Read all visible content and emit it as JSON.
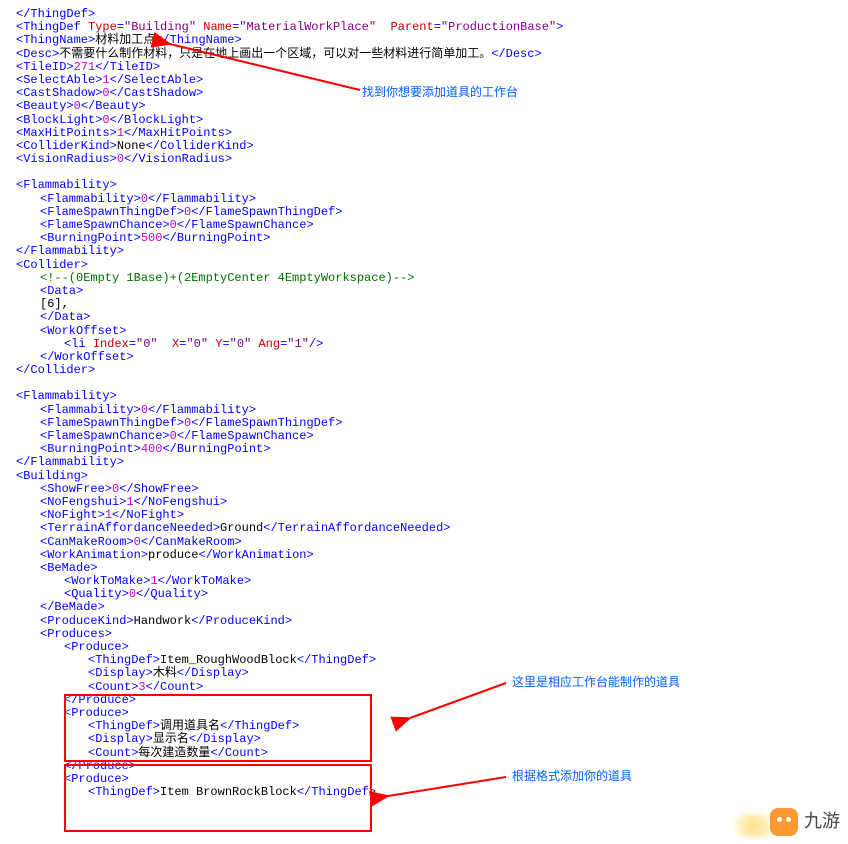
{
  "code": {
    "close_thingdef": "</ThingDef>",
    "thingdef_open": "<ThingDef Type=\"Building\" Name=\"MaterialWorkPlace\"  Parent=\"ProductionBase\">",
    "thingname_open": "<ThingName>",
    "thingname_text": "材料加工点",
    "thingname_close": "</ThingName>",
    "desc_open": "<Desc>",
    "desc_text": "不需要什么制作材料，只是在地上画出一个区域，可以对一些材料进行简单加工。",
    "desc_close": "</Desc>",
    "tileid": {
      "open": "<TileID>",
      "val": "271",
      "close": "</TileID>"
    },
    "selectable": {
      "open": "<SelectAble>",
      "val": "1",
      "close": "</SelectAble>"
    },
    "castshadow": {
      "open": "<CastShadow>",
      "val": "0",
      "close": "</CastShadow>"
    },
    "beauty": {
      "open": "<Beauty>",
      "val": "0",
      "close": "</Beauty>"
    },
    "blocklight": {
      "open": "<BlockLight>",
      "val": "0",
      "close": "</BlockLight>"
    },
    "maxhitpoints": {
      "open": "<MaxHitPoints>",
      "val": "1",
      "close": "</MaxHitPoints>"
    },
    "colliderkind": {
      "open": "<ColliderKind>",
      "val": "None",
      "close": "</ColliderKind>"
    },
    "visionradius": {
      "open": "<VisionRadius>",
      "val": "0",
      "close": "</VisionRadius>"
    },
    "flammability_open": "<Flammability>",
    "flammability_close": "</Flammability>",
    "flammability_inner": {
      "open": "<Flammability>",
      "val": "0",
      "close": "</Flammability>"
    },
    "flamespawnthing": {
      "open": "<FlameSpawnThingDef>",
      "val": "0",
      "close": "</FlameSpawnThingDef>"
    },
    "flamespawnchance": {
      "open": "<FlameSpawnChance>",
      "val": "0",
      "close": "</FlameSpawnChance>"
    },
    "burningpoint500": {
      "open": "<BurningPoint>",
      "val": "500",
      "close": "</BurningPoint>"
    },
    "burningpoint400": {
      "open": "<BurningPoint>",
      "val": "400",
      "close": "</BurningPoint>"
    },
    "collider_open": "<Collider>",
    "collider_close": "</Collider>",
    "collider_comment": "<!--(0Empty 1Base)+(2EmptyCenter 4EmptyWorkspace)-->",
    "data_open": "<Data>",
    "data_val": "[6],",
    "data_close": "</Data>",
    "workoffset_open": "<WorkOffset>",
    "workoffset_close": "</WorkOffset>",
    "li_line": "<li Index=\"0\"  X=\"0\" Y=\"0\" Ang=\"1\"/>",
    "building_open": "<Building>",
    "showfree": {
      "open": "<ShowFree>",
      "val": "0",
      "close": "</ShowFree>"
    },
    "nofengshui": {
      "open": "<NoFengshui>",
      "val": "1",
      "close": "</NoFengshui>"
    },
    "nofight": {
      "open": "<NoFight>",
      "val": "1",
      "close": "</NoFight>"
    },
    "terrainafford": {
      "open": "<TerrainAffordanceNeeded>",
      "val": "Ground",
      "close": "</TerrainAffordanceNeeded>"
    },
    "canmakeroom": {
      "open": "<CanMakeRoom>",
      "val": "0",
      "close": "</CanMakeRoom>"
    },
    "workanimation": {
      "open": "<WorkAnimation>",
      "val": "produce",
      "close": "</WorkAnimation>"
    },
    "bemade_open": "<BeMade>",
    "bemade_close": "</BeMade>",
    "worktomake": {
      "open": "<WorkToMake>",
      "val": "1",
      "close": "</WorkToMake>"
    },
    "quality": {
      "open": "<Quality>",
      "val": "0",
      "close": "</Quality>"
    },
    "producekind": {
      "open": "<ProduceKind>",
      "val": "Handwork",
      "close": "</ProduceKind>"
    },
    "produces_open": "<Produces>",
    "produce_open": "<Produce>",
    "produce_close": "</Produce>",
    "p1_thingdef": {
      "open": "<ThingDef>",
      "val": "Item_RoughWoodBlock",
      "close": "</ThingDef>"
    },
    "p1_display": {
      "open": "<Display>",
      "val": "木料",
      "close": "</Display>"
    },
    "p1_count": {
      "open": "<Count>",
      "val": "3",
      "close": "</Count>"
    },
    "p2_thingdef": {
      "open": "<ThingDef>",
      "val": "调用道具名",
      "close": "</ThingDef>"
    },
    "p2_display": {
      "open": "<Display>",
      "val": "显示名",
      "close": "</Display>"
    },
    "p2_count": {
      "open": "<Count>",
      "val": "每次建造数量",
      "close": "</Count>"
    },
    "p3_thingdef": {
      "open": "<ThingDef>",
      "val": "Item BrownRockBlock",
      "close": "</ThingDef>"
    }
  },
  "annotations": {
    "a1": "找到你想要添加道具的工作台",
    "a2": "这里是相应工作台能制作的道具",
    "a3": "根据格式添加你的道具"
  },
  "logo": "九游"
}
